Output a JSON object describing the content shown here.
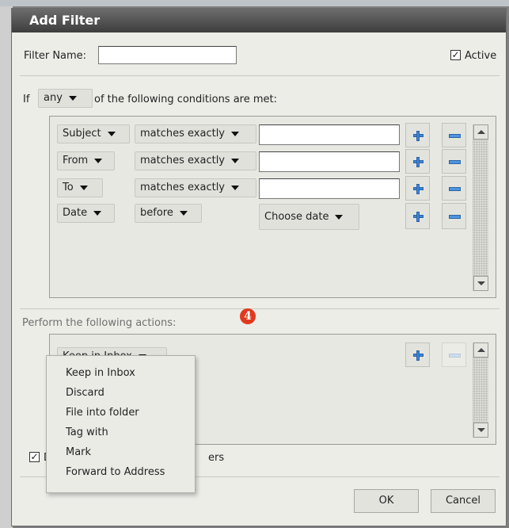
{
  "dialog": {
    "title": "Add Filter"
  },
  "filter_name": {
    "label": "Filter Name:",
    "value": ""
  },
  "active": {
    "label": "Active",
    "checked": true
  },
  "condition_header": {
    "prefix": "If",
    "match": "any",
    "suffix": "of the following conditions are met:"
  },
  "conditions": [
    {
      "field": "Subject",
      "operator": "matches exactly",
      "value": ""
    },
    {
      "field": "From",
      "operator": "matches exactly",
      "value": ""
    },
    {
      "field": "To",
      "operator": "matches exactly",
      "value": ""
    },
    {
      "field": "Date",
      "operator": "before",
      "value": "Choose date"
    }
  ],
  "actions": {
    "header": "Perform the following actions:",
    "selected": "Keep in Inbox"
  },
  "action_menu": {
    "items": [
      "Keep in Inbox",
      "Discard",
      "File into folder",
      "Tag with",
      "Mark",
      "Forward to Address"
    ]
  },
  "annotation": {
    "number": "4",
    "color": "#e0391f"
  },
  "dont_process": {
    "label_start": "Do",
    "label_end": "ers",
    "checked": true
  },
  "buttons": {
    "ok": "OK",
    "cancel": "Cancel"
  },
  "icons": {
    "add": "plus-icon",
    "remove": "minus-icon",
    "dropdown": "caret-down-icon"
  },
  "colors": {
    "accent_blue": "#3d86d6",
    "title_bar": "#4a4a4a"
  }
}
